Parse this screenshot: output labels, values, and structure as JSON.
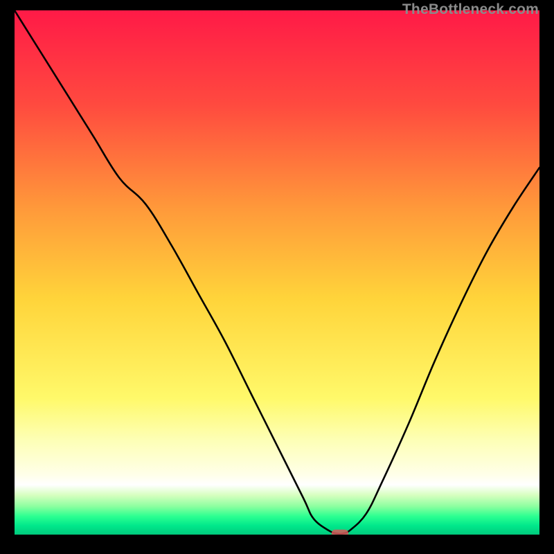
{
  "watermark": "TheBottleneck.com",
  "chart_data": {
    "type": "line",
    "title": "",
    "xlabel": "",
    "ylabel": "",
    "xlim": [
      0,
      100
    ],
    "ylim": [
      0,
      100
    ],
    "gradient_bands": [
      {
        "y": 0,
        "color": "#ff1a47"
      },
      {
        "y": 18,
        "color": "#ff4a3f"
      },
      {
        "y": 38,
        "color": "#ff9a3a"
      },
      {
        "y": 55,
        "color": "#ffd43a"
      },
      {
        "y": 74,
        "color": "#fff96a"
      },
      {
        "y": 82,
        "color": "#fdffb6"
      },
      {
        "y": 88.5,
        "color": "#ffffe8"
      },
      {
        "y": 90.5,
        "color": "#ffffff"
      },
      {
        "y": 92.5,
        "color": "#d6ffbf"
      },
      {
        "y": 94.6,
        "color": "#8dffa0"
      },
      {
        "y": 96.5,
        "color": "#2cff91"
      },
      {
        "y": 98.3,
        "color": "#00e88b"
      },
      {
        "y": 100,
        "color": "#00c97c"
      }
    ],
    "series": [
      {
        "name": "bottleneck-curve",
        "x": [
          0,
          5,
          10,
          15,
          20,
          25,
          30,
          35,
          40,
          45,
          50,
          55,
          57,
          60,
          61.5,
          62.5,
          64,
          67,
          70,
          75,
          80,
          85,
          90,
          95,
          100
        ],
        "y": [
          100,
          92,
          84,
          76,
          68,
          63,
          55,
          46,
          37,
          27,
          17,
          7,
          3,
          0.7,
          0.2,
          0.2,
          0.9,
          4,
          10,
          21,
          33,
          44,
          54,
          62.5,
          70
        ]
      }
    ],
    "marker": {
      "shape": "rounded-rect",
      "x": 62,
      "y": 0.2,
      "width": 3.2,
      "height": 1.5,
      "color": "#d85a5a"
    }
  }
}
